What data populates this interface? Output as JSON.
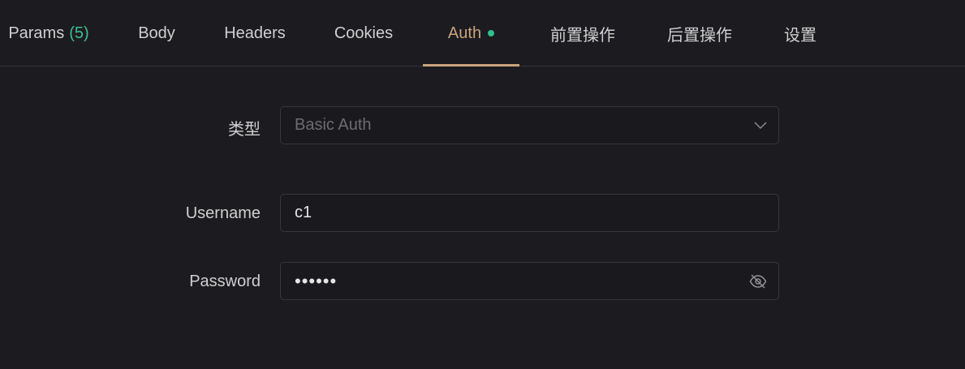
{
  "tabs": [
    {
      "label": "Params",
      "count": "(5)",
      "active": false
    },
    {
      "label": "Body",
      "active": false
    },
    {
      "label": "Headers",
      "active": false
    },
    {
      "label": "Cookies",
      "active": false
    },
    {
      "label": "Auth",
      "active": true,
      "indicator": "green-dot"
    },
    {
      "label": "前置操作",
      "active": false
    },
    {
      "label": "后置操作",
      "active": false
    },
    {
      "label": "设置",
      "active": false
    }
  ],
  "form": {
    "type": {
      "label": "类型",
      "value": "Basic Auth",
      "icon": "chevron-down-icon"
    },
    "username": {
      "label": "Username",
      "value": "c1"
    },
    "password": {
      "label": "Password",
      "value": "••••••",
      "icon": "eye-off-icon"
    }
  },
  "colors": {
    "background": "#1c1c20",
    "accent": "#c9a47c",
    "count": "#3fbf8f",
    "indicator": "#2fbf8a"
  }
}
